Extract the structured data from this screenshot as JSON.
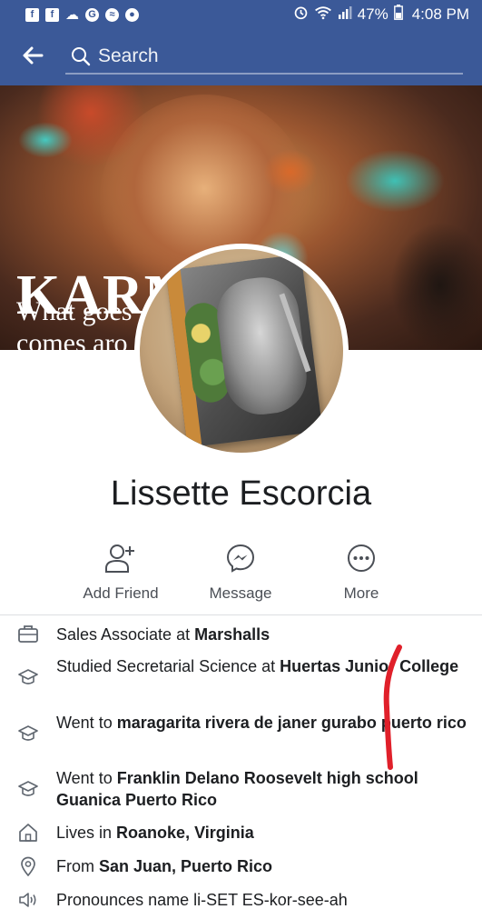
{
  "status_bar": {
    "time": "4:08 PM",
    "battery": "47%",
    "left_icons": [
      "facebook-icon",
      "facebook-icon",
      "weather-icon",
      "google-icon",
      "messenger-icon",
      "alien-icon"
    ],
    "right_icons": [
      "alarm-icon",
      "wifi-icon",
      "signal-icon",
      "battery-icon"
    ]
  },
  "header": {
    "search_placeholder": "Search",
    "background_color": "#3b5998"
  },
  "cover": {
    "text_main": "KARMA",
    "text_sub_line1": "What goes",
    "text_sub_line2": "comes aro"
  },
  "profile": {
    "name": "Lissette Escorcia"
  },
  "actions": [
    {
      "label": "Add Friend",
      "icon": "add-friend-icon"
    },
    {
      "label": "Message",
      "icon": "messenger-icon"
    },
    {
      "label": "More",
      "icon": "more-icon"
    }
  ],
  "intro": [
    {
      "icon": "briefcase-icon",
      "prefix": "Sales Associate at ",
      "bold": "Marshalls",
      "suffix": ""
    },
    {
      "icon": "graduation-cap-icon",
      "prefix": "Studied Secretarial Science at ",
      "bold": "Huertas Junior College",
      "suffix": ""
    },
    {
      "icon": "graduation-cap-icon",
      "prefix": "Went to ",
      "bold": "maragarita rivera de janer gurabo puerto rico",
      "suffix": ""
    },
    {
      "icon": "graduation-cap-icon",
      "prefix": "Went to ",
      "bold": "Franklin Delano Roosevelt high school Guanica Puerto Rico",
      "suffix": ""
    },
    {
      "icon": "home-icon",
      "prefix": "Lives in ",
      "bold": "Roanoke, Virginia",
      "suffix": ""
    },
    {
      "icon": "location-pin-icon",
      "prefix": "From ",
      "bold": "San Juan, Puerto Rico",
      "suffix": ""
    },
    {
      "icon": "speaker-icon",
      "prefix": "Pronounces name li-SET ES-kor-see-ah",
      "bold": "",
      "suffix": ""
    }
  ],
  "colors": {
    "brand": "#3b5998",
    "text": "#1c1e21",
    "secondary_text": "#4b4f56",
    "icon_gray": "#606770",
    "marker_red": "#e0202a"
  }
}
